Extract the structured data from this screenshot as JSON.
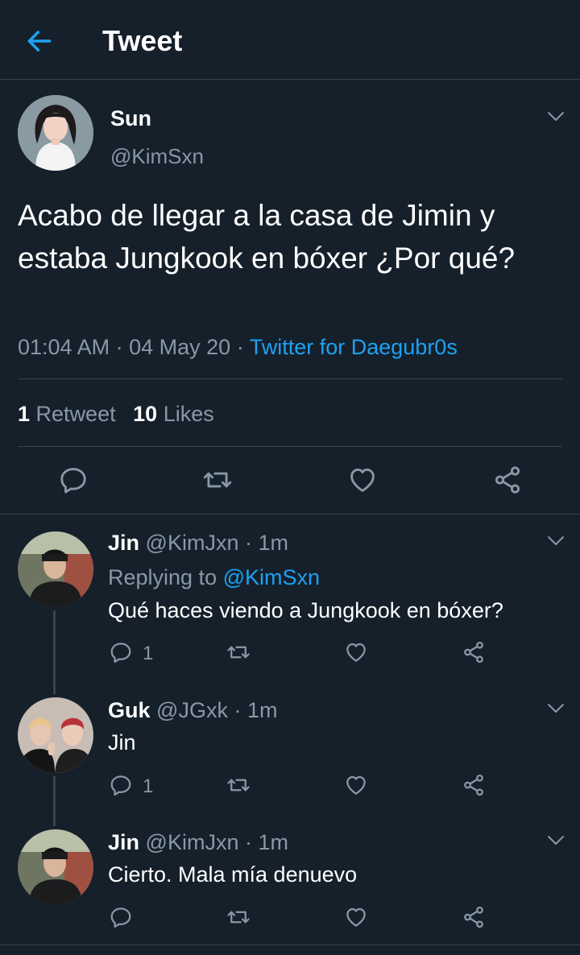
{
  "header": {
    "title": "Tweet"
  },
  "main_tweet": {
    "name": "Sun",
    "handle": "@KimSxn",
    "text": "Acabo de llegar a la casa de Jimin y estaba Jungkook en bóxer ¿Por qué?",
    "time": "01:04 AM",
    "date": "04 May 20",
    "sep": "·",
    "source": "Twitter for Daegubr0s",
    "retweets_count": "1",
    "retweets_label": "Retweet",
    "likes_count": "10",
    "likes_label": "Likes"
  },
  "replies": [
    {
      "name": "Jin",
      "handle": "@KimJxn",
      "time": "· 1m",
      "replying_label": "Replying to",
      "replying_handle": "@KimSxn",
      "text": "Qué haces viendo a Jungkook en bóxer?",
      "reply_count": "1"
    },
    {
      "name": "Guk",
      "handle": "@JGxk",
      "time": "· 1m",
      "text": "Jin",
      "reply_count": "1"
    },
    {
      "name": "Jin",
      "handle": "@KimJxn",
      "time": "· 1m",
      "text": "Cierto. Mala mía denuevo",
      "reply_count": ""
    }
  ],
  "colors": {
    "background": "#15202b",
    "accent": "#1da1f2",
    "muted": "#8899a6",
    "divider": "#38444d"
  },
  "icons": [
    "back-arrow-icon",
    "chevron-down-icon",
    "reply-icon",
    "retweet-icon",
    "like-icon",
    "share-icon"
  ]
}
